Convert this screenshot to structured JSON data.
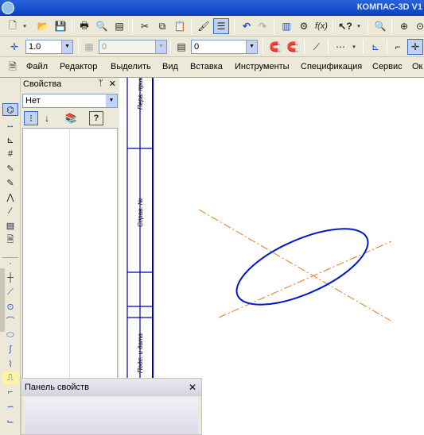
{
  "app": {
    "title": "КОМПАС-3D V1"
  },
  "toolbar1": {
    "icons": [
      "new-document-icon",
      "open-icon",
      "save-icon",
      "print-icon",
      "print-preview-icon",
      "cut-icon",
      "copy-icon",
      "paste-icon",
      "properties-icon",
      "undo-icon",
      "redo-icon",
      "manager-icon",
      "variables-icon",
      "function-icon",
      "help-pointer-icon",
      "zoom-icon",
      "zoom-fit-icon"
    ]
  },
  "toolbar2": {
    "scale_value": "1.0",
    "disabled_value": "0",
    "layer_value": "0"
  },
  "menu": {
    "items": [
      "Файл",
      "Редактор",
      "Выделить",
      "Вид",
      "Вставка",
      "Инструменты",
      "Спецификация",
      "Сервис",
      "Ок"
    ]
  },
  "properties": {
    "title": "Свойства",
    "pin": "ᛘ",
    "close": "✕",
    "select_value": "Нет",
    "help": "?"
  },
  "panel": {
    "title": "Панель свойств",
    "close": "✕"
  },
  "frame_labels": [
    "Перв. прим",
    "Справ. №",
    "Подп. и дата"
  ],
  "colors": {
    "ellipse": "#0018c8",
    "axis": "#e07a1a",
    "frame": "#0000aa"
  }
}
